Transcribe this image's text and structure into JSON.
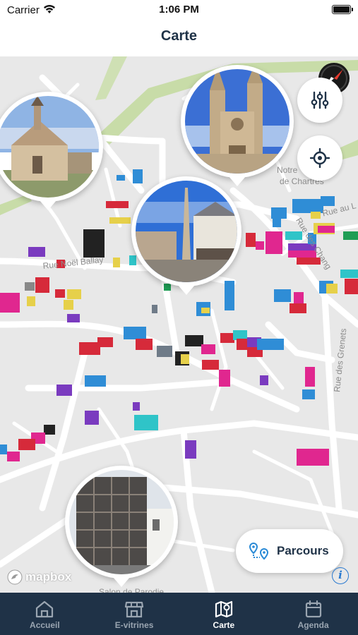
{
  "status_bar": {
    "carrier": "Carrier",
    "time": "1:06 PM"
  },
  "header": {
    "title": "Carte"
  },
  "map": {
    "streets": [
      "Notre",
      "de Chartres",
      "Rue au L",
      "Rue des Chang",
      "Rue Noël Ballay",
      "Rue des Grenets",
      "Salon de Parodie"
    ],
    "attribution": "mapbox",
    "parcours_label": "Parcours",
    "info_label": "i"
  },
  "tabs": [
    {
      "label": "Accueil",
      "icon": "home-icon",
      "active": false
    },
    {
      "label": "E-vitrines",
      "icon": "storefront-icon",
      "active": false
    },
    {
      "label": "Carte",
      "icon": "map-icon",
      "active": true
    },
    {
      "label": "Agenda",
      "icon": "calendar-icon",
      "active": false
    }
  ],
  "colors": {
    "navy": "#1f3247",
    "accent_blue": "#2a7ad0",
    "map_bg": "#e9e9e9",
    "park_green": "#c8dca8"
  }
}
